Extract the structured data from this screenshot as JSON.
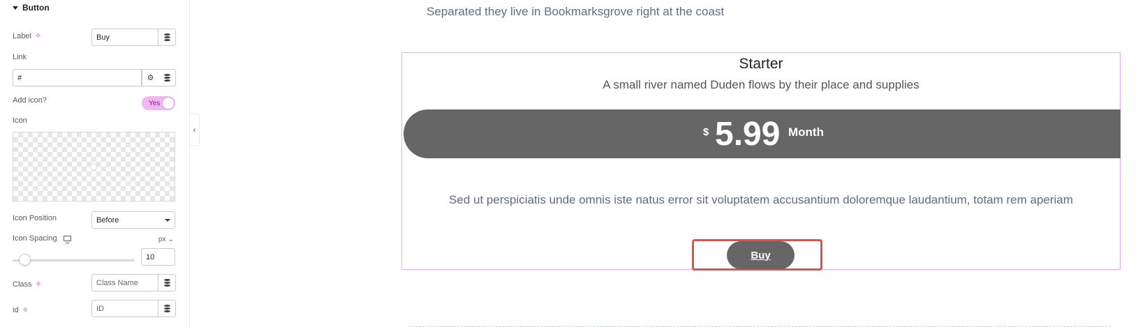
{
  "panel": {
    "section_title": "Button",
    "label": {
      "text": "Label",
      "value": "Buy"
    },
    "link": {
      "text": "Link",
      "value": "#"
    },
    "add_icon": {
      "text": "Add icon?",
      "toggle": "Yes"
    },
    "icon": {
      "text": "Icon"
    },
    "icon_position": {
      "text": "Icon Position",
      "value": "Before"
    },
    "icon_spacing": {
      "text": "Icon Spacing",
      "unit": "px",
      "value": "10"
    },
    "class": {
      "text": "Class",
      "placeholder": "Class Name"
    },
    "id": {
      "text": "id",
      "placeholder": "ID"
    }
  },
  "canvas": {
    "top_text": "Separated they live in Bookmarksgrove right at the coast",
    "card": {
      "title": "Starter",
      "subtitle": "A small river named Duden flows by their place and supplies",
      "currency": "$",
      "price": "5.99",
      "period": "Month",
      "description": "Sed ut perspiciatis unde omnis iste natus error sit voluptatem accusantium doloremque laudantium, totam rem aperiam",
      "button": "Buy"
    }
  },
  "colors": {
    "accent": "#c12dd1",
    "price_bar": "#666666",
    "highlight": "#e3504a",
    "card_border": "#f0a8f5"
  }
}
